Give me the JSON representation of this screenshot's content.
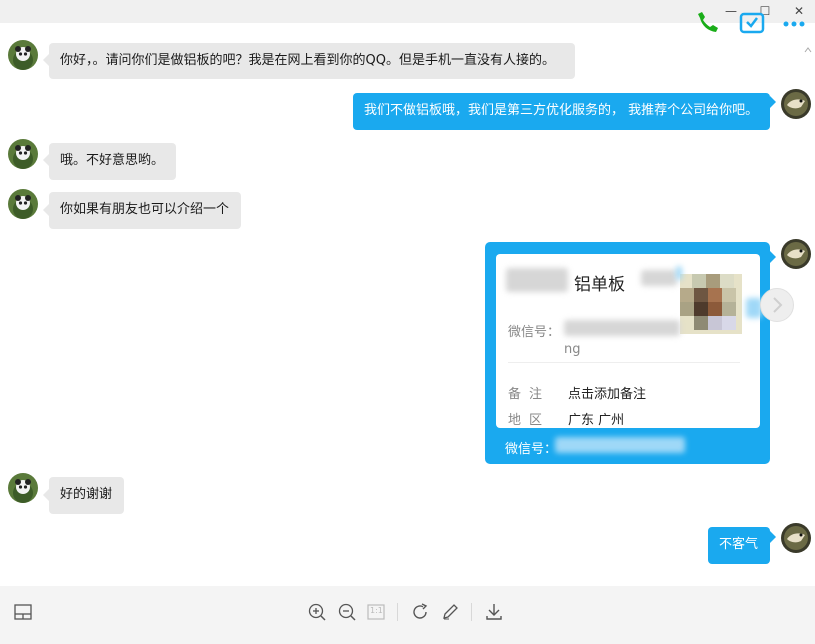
{
  "window": {
    "min_label": "—",
    "max_label": "☐",
    "close_label": "✕"
  },
  "messages": [
    {
      "side": "left",
      "text": "你好，。请问你们是做铝板的吧？我是在网上看到你的QQ。但是手机一直没有人接的。"
    },
    {
      "side": "right",
      "text": "我们不做铝板哦，我们是第三方优化服务的， 我推荐个公司给你吧。"
    },
    {
      "side": "left",
      "text": "哦。不好意思哟。"
    },
    {
      "side": "left",
      "text": "你如果有朋友也可以介绍一个"
    },
    {
      "side": "left",
      "text": "好的谢谢"
    },
    {
      "side": "right",
      "text": "不客气"
    }
  ],
  "contact_card": {
    "name_visible": "铝单板",
    "wechat_id_label": "微信号：",
    "wechat_id_tail": "ng",
    "remark_label": "备注",
    "remark_value": "点击添加备注",
    "region_label": "地区",
    "region_value": "广东 广州",
    "footer_label": "微信号："
  },
  "toolbar": {
    "layout_icon": "layout-icon",
    "zoom_in_icon": "zoom-in-icon",
    "zoom_out_icon": "zoom-out-icon",
    "actual_size_icon": "actual-size-icon",
    "rotate_icon": "rotate-icon",
    "edit_icon": "edit-icon",
    "download_icon": "download-icon",
    "actual_size_label": "1:1"
  },
  "colors": {
    "bubble_right": "#1aa9ef",
    "bubble_left": "#e8e8e8",
    "accent_green": "#1aad19"
  }
}
